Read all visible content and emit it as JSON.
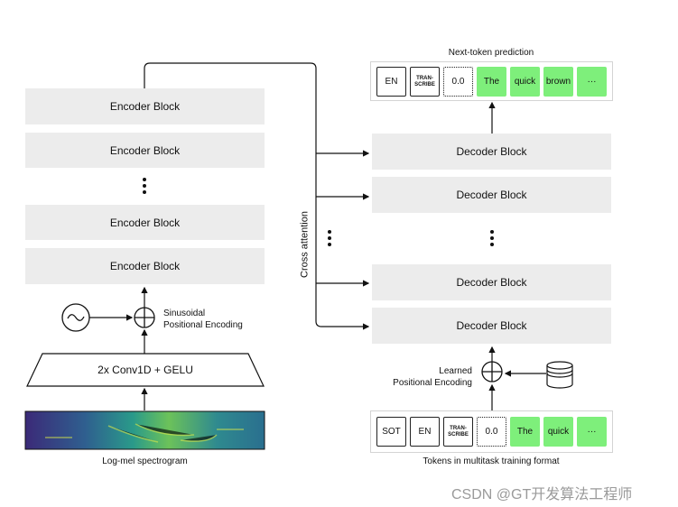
{
  "encoder": {
    "blocks": [
      "Encoder Block",
      "Encoder Block",
      "Encoder Block",
      "Encoder Block"
    ],
    "conv": "2x Conv1D + GELU",
    "pos_enc": [
      "Sinusoidal",
      "Positional Encoding"
    ],
    "spectrogram": "Log-mel spectrogram"
  },
  "cross_attention": "Cross attention",
  "decoder": {
    "blocks": [
      "Decoder Block",
      "Decoder Block",
      "Decoder Block",
      "Decoder Block"
    ],
    "pos_enc": [
      "Learned",
      "Positional Encoding"
    ]
  },
  "output": {
    "title": "Next-token prediction",
    "tokens": [
      "EN",
      "TRAN-\nSCRIBE",
      "0.0",
      "The",
      "quick",
      "brown",
      "···"
    ]
  },
  "input": {
    "title": "Tokens in multitask training format",
    "tokens": [
      "SOT",
      "EN",
      "TRAN-\nSCRIBE",
      "0.0",
      "The",
      "quick",
      "···"
    ]
  },
  "watermark": "CSDN @GT开发算法工程师",
  "colors": {
    "block": "#ececec",
    "text_token": "#7eef7b"
  }
}
